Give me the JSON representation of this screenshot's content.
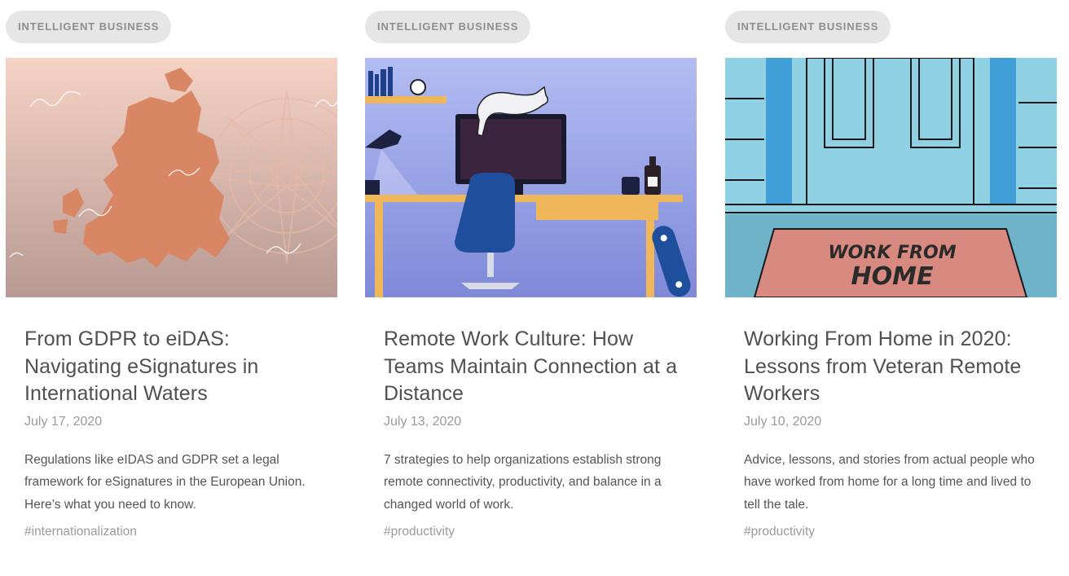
{
  "articles": [
    {
      "category": "INTELLIGENT BUSINESS",
      "title": "From GDPR to eiDAS: Navigating eSignatures in International Waters",
      "date": "July 17, 2020",
      "excerpt": "Regulations like eIDAS and GDPR set a legal framework for eSignatures in the European Union. Here’s what you need to know.",
      "tag": "#internationalization",
      "image_name": "europe-map-compass-illustration"
    },
    {
      "category": "INTELLIGENT BUSINESS",
      "title": "Remote Work Culture: How Teams Maintain Connection at a Distance",
      "date": "July 13, 2020",
      "excerpt": "7 strategies to help organizations establish strong remote connectivity, productivity, and balance in a changed world of work.",
      "tag": "#productivity",
      "image_name": "home-office-desk-cat-illustration"
    },
    {
      "category": "INTELLIGENT BUSINESS",
      "title": "Working From Home in 2020: Lessons from Veteran Remote Workers",
      "date": "July 10, 2020",
      "excerpt": "Advice, lessons, and stories from actual people who have worked from home for a long time and lived to tell the tale.",
      "tag": "#productivity",
      "image_name": "work-from-home-doormat-illustration",
      "image_text": [
        "WORK FROM",
        "HOME"
      ]
    }
  ],
  "colors": {
    "badge_bg": "#e6e6e6",
    "badge_text": "#8e8e8e",
    "title": "#505050",
    "meta": "#9a9a9a"
  }
}
